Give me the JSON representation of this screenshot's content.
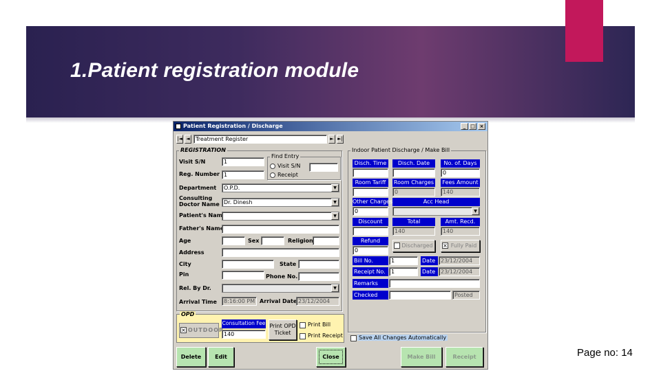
{
  "slide": {
    "title": "1.Patient registration module",
    "page_no": "Page no: 14"
  },
  "window": {
    "title": "Patient Registration / Discharge",
    "minimize_glyph": "_",
    "maximize_glyph": "□",
    "close_glyph": "×",
    "icon": "app-icon"
  },
  "nav": {
    "first": "|◄",
    "prev": "◄",
    "next": "►",
    "last": "►|",
    "register_value": "Treatment Register"
  },
  "registration": {
    "group_title": "REGISTRATION",
    "visit_sn_label": "Visit S/N",
    "visit_sn_value": "1",
    "reg_number_label": "Reg. Number",
    "reg_number_value": "1",
    "find_entry_title": "Find Entry",
    "find_visit_sn": "Visit S/N",
    "find_receipt": "Receipt",
    "department_label": "Department",
    "department_value": "O.P.D.",
    "consulting_label_1": "Consulting",
    "consulting_label_2": "Doctor Name",
    "doctor_value": "Dr. Dinesh",
    "patient_name_label": "Patient's Name",
    "father_name_label": "Father's Name",
    "age_label": "Age",
    "sex_label": "Sex",
    "religion_label": "Religion",
    "address_label": "Address",
    "city_label": "City",
    "state_label": "State",
    "pin_label": "Pin",
    "phone_label": "Phone No.",
    "rel_by_dr_label": "Rel. By Dr.",
    "arrival_time_label": "Arrival Time",
    "arrival_time_value": "8:16:00 PM",
    "arrival_date_label": "Arrival Date",
    "arrival_date_value": "23/12/2004"
  },
  "opd": {
    "group_title": "OPD",
    "outdoor_label": "OUTDOOR",
    "consultation_fee_label": "Consultation Fee",
    "consultation_fee_value": "140",
    "print_opd_ticket_1": "Print OPD",
    "print_opd_ticket_2": "Ticket",
    "print_bill": "Print Bill",
    "print_receipt": "Print Receipt"
  },
  "discharge": {
    "group_title": "Indoor Patient Discharge / Make Bill",
    "disch_time": "Disch. Time",
    "disch_date": "Disch. Date",
    "no_of_days": "No. of. Days",
    "no_of_days_value": "0",
    "room_tariff": "Room Tariff",
    "room_charges": "Room Charges",
    "room_charges_value": "0",
    "fees_amount": "Fees Amount",
    "fees_amount_value": "140",
    "other_charges": "Other Charges",
    "other_charges_value": "0",
    "acc_head": "Acc Head",
    "discount": "Discount",
    "total": "Total",
    "total_value": "140",
    "amt_recd": "Amt. Recd.",
    "amt_recd_value": "140",
    "refund": "Refund",
    "refund_value": "0",
    "discharged": "Discharged",
    "fully_paid": "Fully Paid",
    "bill_no": "Bill No.",
    "bill_no_value": "1",
    "date_label": "Date",
    "bill_date_value": "23/12/2004",
    "receipt_no": "Receipt No.",
    "receipt_no_value": "1",
    "receipt_date_value": "23/12/2004",
    "remarks": "Remarks",
    "checked": "Checked",
    "posted": "Posted",
    "save_all": "Save All Changes Automatically"
  },
  "buttons": {
    "delete": "Delete",
    "edit": "Edit",
    "close": "Close",
    "make_bill": "Make Bill",
    "receipt": "Receipt"
  },
  "colors": {
    "accent_pink": "#c2185b",
    "header_blue": "#0000cc",
    "opd_yellow": "#fff3b0"
  }
}
